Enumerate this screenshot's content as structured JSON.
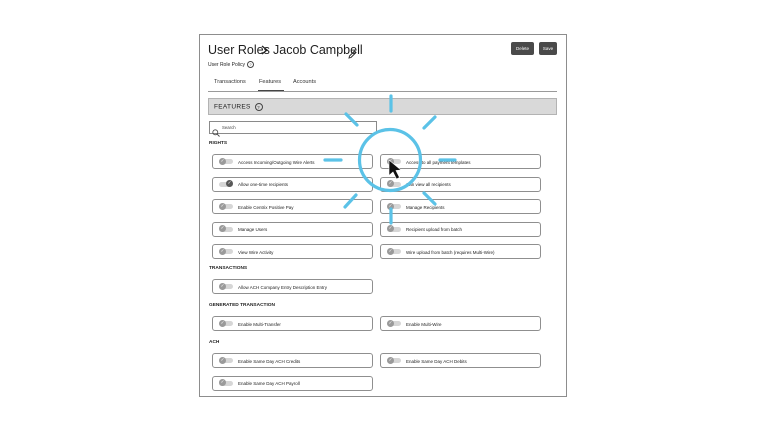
{
  "header": {
    "title": "User Roles",
    "user_name": "Jacob Campbell",
    "delete_label": "Delete",
    "save_label": "Save",
    "policy_label": "User Role Policy"
  },
  "tabs": [
    {
      "label": "Transactions"
    },
    {
      "label": "Features"
    },
    {
      "label": "Accounts"
    }
  ],
  "features": {
    "heading": "FEATURES",
    "search_placeholder": "Search"
  },
  "sections": {
    "rights": "RIGHTS",
    "transactions": "TRANSACTIONS",
    "generated": "GENERATED TRANSACTION",
    "ach": "ACH"
  },
  "permissions": {
    "rights": [
      {
        "label": "Access Incoming/Outgoing Wire Alerts",
        "enabled": false
      },
      {
        "label": "Access to all payment templates",
        "enabled": false
      },
      {
        "label": "Allow one-time recipients",
        "enabled": true
      },
      {
        "label": "Can view all recipients",
        "enabled": false
      },
      {
        "label": "Enable Centrix Positive Pay",
        "enabled": false
      },
      {
        "label": "Manage Recipients",
        "enabled": false
      },
      {
        "label": "Manage Users",
        "enabled": false
      },
      {
        "label": "Recipient upload from batch",
        "enabled": false
      },
      {
        "label": "View Wire Activity",
        "enabled": false
      },
      {
        "label": "Wire upload from batch (requires Multi-Wire)",
        "enabled": false
      }
    ],
    "transactions": [
      {
        "label": "Allow ACH Company Entry Description Entry",
        "enabled": false
      }
    ],
    "generated": [
      {
        "label": "Enable Multi-Transfer",
        "enabled": false
      },
      {
        "label": "Enable Multi-Wire",
        "enabled": false
      }
    ],
    "ach": [
      {
        "label": "Enable Same Day ACH Credits",
        "enabled": false
      },
      {
        "label": "Enable Same Day ACH Debits",
        "enabled": false
      },
      {
        "label": "Enable Same Day ACH Payroll",
        "enabled": false
      }
    ]
  },
  "colors": {
    "highlight": "#5bc2e7",
    "band": "#d9d9d9",
    "button": "#4a4a4a"
  },
  "icons": {
    "chevron": "chevron-right-icon",
    "edit": "pencil-icon",
    "help": "question-circle-icon",
    "search": "search-icon",
    "cursor": "pointer-cursor-icon",
    "check": "check-icon"
  }
}
